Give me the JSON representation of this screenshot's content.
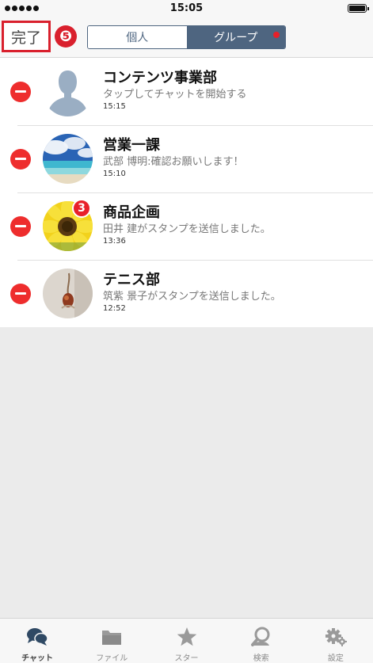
{
  "status_bar": {
    "time": "15:05"
  },
  "nav": {
    "done_label": "完了",
    "step_badge": "❺",
    "segments": [
      {
        "label": "個人",
        "active": false
      },
      {
        "label": "グループ",
        "active": true
      }
    ]
  },
  "chats": [
    {
      "title": "コンテンツ事業部",
      "preview": "タップしてチャットを開始する",
      "time": "15:15",
      "avatar": "default-person"
    },
    {
      "title": "営業一課",
      "preview": "武部 博明:確認お願いします！",
      "time": "15:10",
      "avatar": "beach-photo"
    },
    {
      "title": "商品企画",
      "preview": "田井 建がスタンプを送信しました。",
      "time": "13:36",
      "avatar": "sunflower-photo",
      "unread": "3"
    },
    {
      "title": "テニス部",
      "preview": "筑紫 景子がスタンプを送信しました。",
      "time": "12:52",
      "avatar": "object-photo"
    }
  ],
  "tabbar": {
    "tabs": [
      {
        "label": "チャット",
        "icon": "chat-bubbles-icon",
        "selected": true
      },
      {
        "label": "ファイル",
        "icon": "folder-icon",
        "selected": false
      },
      {
        "label": "スター",
        "icon": "star-icon",
        "selected": false
      },
      {
        "label": "検索",
        "icon": "search-icon",
        "selected": false
      },
      {
        "label": "設定",
        "icon": "gear-icon",
        "selected": false
      }
    ]
  },
  "colors": {
    "accent": "#4e6580",
    "delete": "#ee2d2d",
    "highlight": "#d9202d",
    "tab_active": "#2f4964",
    "tab_inactive": "#9a9a9a"
  }
}
